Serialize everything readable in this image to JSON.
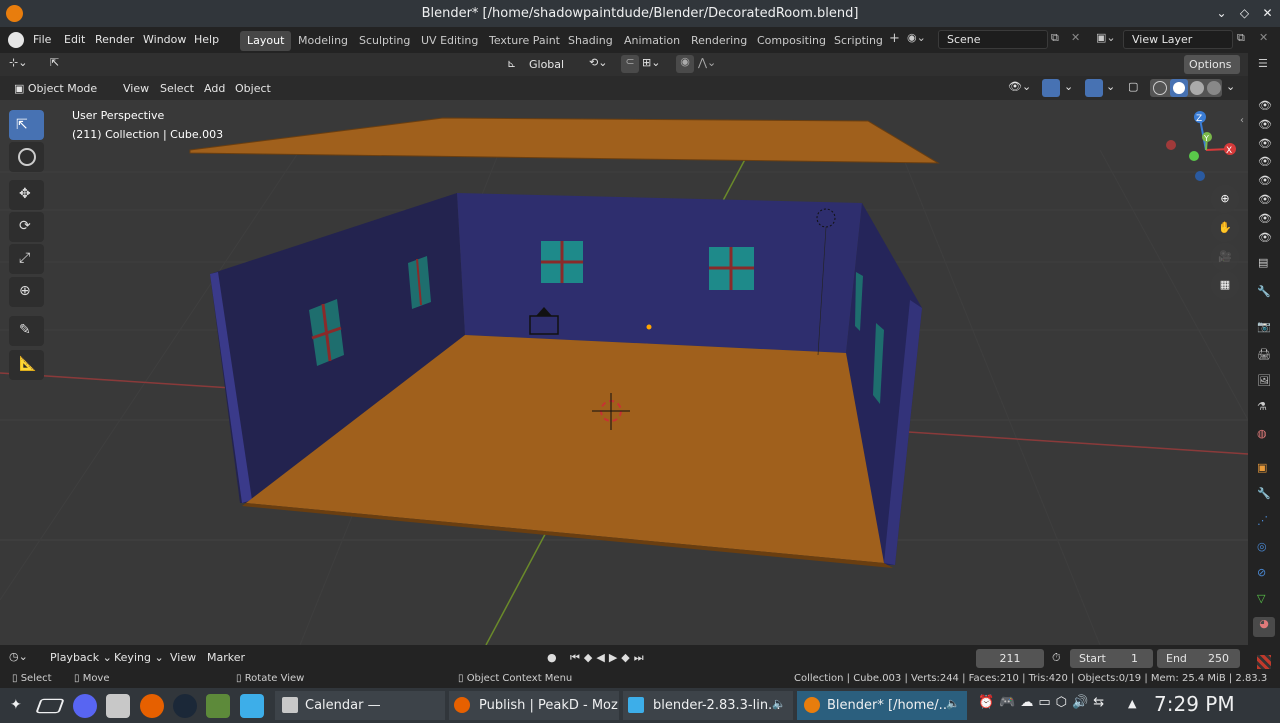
{
  "window": {
    "title": "Blender* [/home/shadowpaintdude/Blender/DecoratedRoom.blend]"
  },
  "menu": [
    "File",
    "Edit",
    "Render",
    "Window",
    "Help"
  ],
  "workspaces": [
    "Layout",
    "Modeling",
    "Sculpting",
    "UV Editing",
    "Texture Paint",
    "Shading",
    "Animation",
    "Rendering",
    "Compositing",
    "Scripting"
  ],
  "scene": {
    "name": "Scene",
    "view_layer": "View Layer"
  },
  "header": {
    "transform_orientation": "Global",
    "options": "Options"
  },
  "viewport_header": {
    "mode": "Object Mode",
    "menus": [
      "View",
      "Select",
      "Add",
      "Object"
    ]
  },
  "viewport": {
    "perspective": "User Perspective",
    "collection_info": "(211) Collection | Cube.003"
  },
  "gizmo": {
    "x": "X",
    "y": "Y",
    "z": "Z"
  },
  "timeline": {
    "playback": "Playback",
    "keying": "Keying",
    "view": "View",
    "marker": "Marker",
    "current_frame": "211",
    "start_label": "Start",
    "start": "1",
    "end_label": "End",
    "end": "250"
  },
  "statusbar": {
    "select": "Select",
    "move": "Move",
    "rotate": "Rotate View",
    "context": "Object Context Menu",
    "stats": "Collection | Cube.003 | Verts:244 | Faces:210 | Tris:420 | Objects:0/19 | Mem: 25.4 MiB | 2.83.3"
  },
  "taskbar": {
    "tasks": [
      "Calendar —",
      "Publish | PeakD - Moz...",
      "blender-2.83.3-lin...",
      "Blender* [/home/..."
    ],
    "clock": "7:29 PM"
  },
  "colors": {
    "accent": "#4772b3",
    "floor": "#a0601c",
    "wall": "#2e2e6e",
    "window": "#1e8a8a"
  }
}
